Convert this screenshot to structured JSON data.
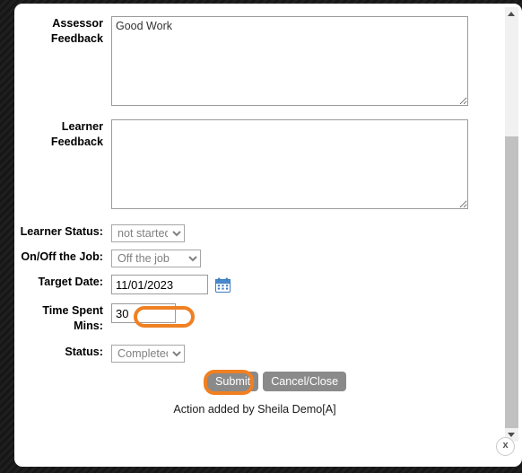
{
  "dialog": {
    "close_label": "x"
  },
  "fields": {
    "assessor_feedback": {
      "label": "Assessor\nFeedback",
      "value": "Good Work",
      "placeholder": ""
    },
    "learner_feedback": {
      "label": "Learner\nFeedback",
      "value": "",
      "placeholder": ""
    },
    "learner_status": {
      "label": "Learner Status:",
      "value": "not started",
      "options": [
        "not started"
      ]
    },
    "on_off_job": {
      "label": "On/Off the Job:",
      "value": "Off the job",
      "options": [
        "Off the job"
      ]
    },
    "target_date": {
      "label": "Target Date:",
      "value": "11/01/2023",
      "placeholder": "",
      "icon": "calendar-icon"
    },
    "time_spent": {
      "label": "Time Spent\nMins:",
      "value": "30",
      "placeholder": ""
    },
    "status": {
      "label": "Status:",
      "value": "Completed",
      "options": [
        "Completed"
      ]
    }
  },
  "buttons": {
    "submit": "Submit",
    "cancel": "Cancel/Close"
  },
  "footer": {
    "action_note": "Action added by Sheila Demo[A]"
  },
  "scrollbar": {
    "up_icon": "chevron-up-icon",
    "down_icon": "chevron-down-icon"
  },
  "colors": {
    "highlight": "#f08022",
    "button_gray": "#8a8a8a",
    "scroll_thumb": "#c1c1c1",
    "calendar_icon": "#3f7cc0"
  }
}
